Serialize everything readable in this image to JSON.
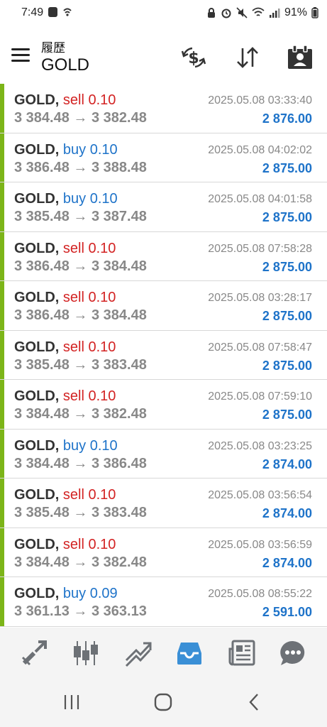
{
  "status": {
    "time": "7:49",
    "battery": "91%"
  },
  "header": {
    "title_small": "履歴",
    "title": "GOLD",
    "icons": [
      "menu-icon",
      "exchange-dollar-icon",
      "sort-icon",
      "contact-card-icon"
    ]
  },
  "trades": [
    {
      "symbol": "GOLD,",
      "type": "sell",
      "volume": "0.10",
      "prices": "3 384.48 → 3 382.48",
      "time": "2025.05.08 03:33:40",
      "profit": "2 876.00"
    },
    {
      "symbol": "GOLD,",
      "type": "buy",
      "volume": "0.10",
      "prices": "3 386.48 → 3 388.48",
      "time": "2025.05.08 04:02:02",
      "profit": "2 875.00"
    },
    {
      "symbol": "GOLD,",
      "type": "buy",
      "volume": "0.10",
      "prices": "3 385.48 → 3 387.48",
      "time": "2025.05.08 04:01:58",
      "profit": "2 875.00"
    },
    {
      "symbol": "GOLD,",
      "type": "sell",
      "volume": "0.10",
      "prices": "3 386.48 → 3 384.48",
      "time": "2025.05.08 07:58:28",
      "profit": "2 875.00"
    },
    {
      "symbol": "GOLD,",
      "type": "sell",
      "volume": "0.10",
      "prices": "3 386.48 → 3 384.48",
      "time": "2025.05.08 03:28:17",
      "profit": "2 875.00"
    },
    {
      "symbol": "GOLD,",
      "type": "sell",
      "volume": "0.10",
      "prices": "3 385.48 → 3 383.48",
      "time": "2025.05.08 07:58:47",
      "profit": "2 875.00"
    },
    {
      "symbol": "GOLD,",
      "type": "sell",
      "volume": "0.10",
      "prices": "3 384.48 → 3 382.48",
      "time": "2025.05.08 07:59:10",
      "profit": "2 875.00"
    },
    {
      "symbol": "GOLD,",
      "type": "buy",
      "volume": "0.10",
      "prices": "3 384.48 → 3 386.48",
      "time": "2025.05.08 03:23:25",
      "profit": "2 874.00"
    },
    {
      "symbol": "GOLD,",
      "type": "sell",
      "volume": "0.10",
      "prices": "3 385.48 → 3 383.48",
      "time": "2025.05.08 03:56:54",
      "profit": "2 874.00"
    },
    {
      "symbol": "GOLD,",
      "type": "sell",
      "volume": "0.10",
      "prices": "3 384.48 → 3 382.48",
      "time": "2025.05.08 03:56:59",
      "profit": "2 874.00"
    },
    {
      "symbol": "GOLD,",
      "type": "buy",
      "volume": "0.09",
      "prices": "3 361.13 → 3 363.13",
      "time": "2025.05.08 08:55:22",
      "profit": "2 591.00"
    }
  ],
  "colors": {
    "sell": "#d32323",
    "buy": "#1e73c9",
    "profit": "#1e73c9",
    "row_bar": "#7cb518",
    "nav_active": "#3a8fd6",
    "nav_inactive": "#6d7176"
  },
  "bottom_nav": {
    "active_index": 3,
    "items": [
      "quotes-icon",
      "chart-candles-icon",
      "trade-icon",
      "history-inbox-icon",
      "news-icon",
      "chat-icon"
    ]
  },
  "system_nav": [
    "recents-icon",
    "home-icon",
    "back-icon"
  ]
}
